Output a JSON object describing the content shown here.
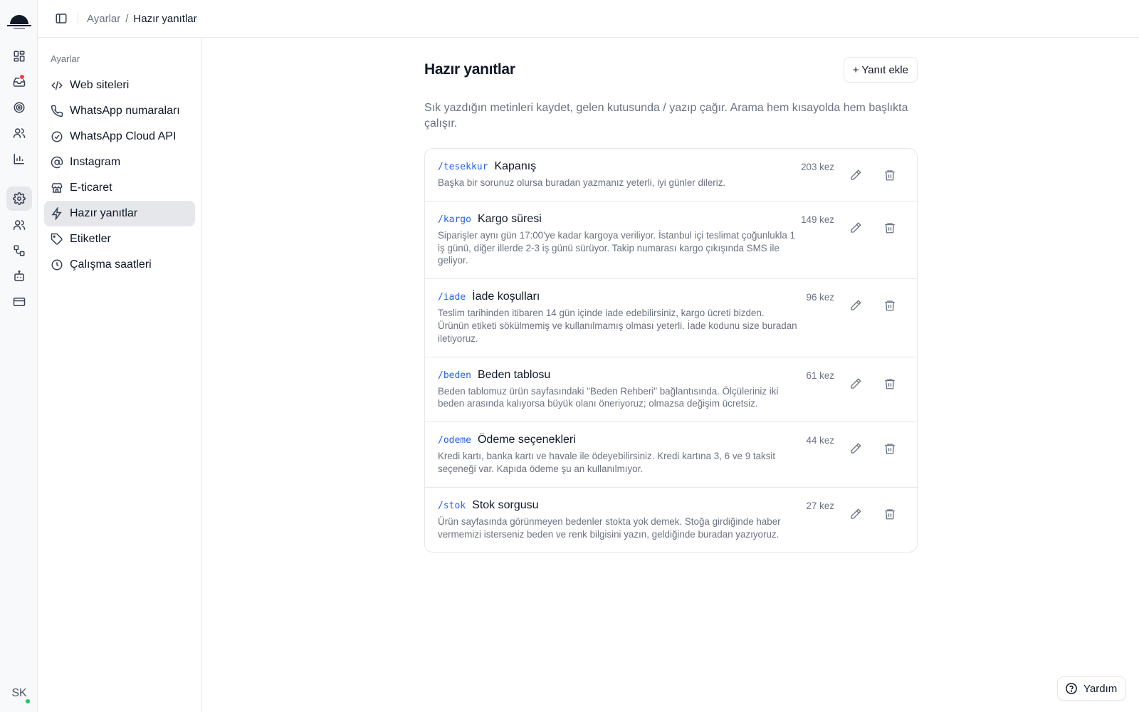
{
  "app": {
    "avatar_initials": "SK"
  },
  "breadcrumb": {
    "parent": "Ayarlar",
    "separator": "/",
    "current": "Hazır yanıtlar"
  },
  "rail": {
    "items": [
      {
        "icon": "dashboard-icon"
      },
      {
        "icon": "inbox-icon",
        "badge_color": "#ef4444"
      },
      {
        "icon": "target-icon"
      },
      {
        "icon": "contacts-icon"
      },
      {
        "icon": "chart-icon"
      },
      {
        "icon": "gear-icon",
        "active": true
      },
      {
        "icon": "team-icon"
      },
      {
        "icon": "flow-icon"
      },
      {
        "icon": "bot-icon"
      },
      {
        "icon": "card-icon"
      }
    ]
  },
  "settings_nav": {
    "title": "Ayarlar",
    "items": [
      {
        "label": "Web siteleri",
        "icon": "code-icon"
      },
      {
        "label": "WhatsApp numaraları",
        "icon": "phone-icon"
      },
      {
        "label": "WhatsApp Cloud API",
        "icon": "check-circle-icon"
      },
      {
        "label": "Instagram",
        "icon": "at-icon"
      },
      {
        "label": "E-ticaret",
        "icon": "store-icon"
      },
      {
        "label": "Hazır yanıtlar",
        "icon": "zap-icon",
        "active": true
      },
      {
        "label": "Etiketler",
        "icon": "tag-icon"
      },
      {
        "label": "Çalışma saatleri",
        "icon": "clock-icon"
      }
    ]
  },
  "page": {
    "title": "Hazır yanıtlar",
    "add_button": "+ Yanıt ekle",
    "description": "Sık yazdığın metinleri kaydet, gelen kutusunda / yazıp çağır. Arama hem kısayolda hem başlıkta çalışır."
  },
  "replies": [
    {
      "shortcut": "/tesekkur",
      "title": "Kapanış",
      "count": "203 kez",
      "body": "Başka bir sorunuz olursa buradan yazmanız yeterli, iyi günler dileriz."
    },
    {
      "shortcut": "/kargo",
      "title": "Kargo süresi",
      "count": "149 kez",
      "body": "Siparişler aynı gün 17:00'ye kadar kargoya veriliyor. İstanbul içi teslimat çoğunlukla 1 iş günü, diğer illerde 2-3 iş günü sürüyor. Takip numarası kargo çıkışında SMS ile geliyor."
    },
    {
      "shortcut": "/iade",
      "title": "İade koşulları",
      "count": "96 kez",
      "body": "Teslim tarihinden itibaren 14 gün içinde iade edebilirsiniz, kargo ücreti bizden. Ürünün etiketi sökülmemiş ve kullanılmamış olması yeterli. İade kodunu size buradan iletiyoruz."
    },
    {
      "shortcut": "/beden",
      "title": "Beden tablosu",
      "count": "61 kez",
      "body": "Beden tablomuz ürün sayfasındaki \"Beden Rehberi\" bağlantısında. Ölçüleriniz iki beden arasında kalıyorsa büyük olanı öneriyoruz; olmazsa değişim ücretsiz."
    },
    {
      "shortcut": "/odeme",
      "title": "Ödeme seçenekleri",
      "count": "44 kez",
      "body": "Kredi kartı, banka kartı ve havale ile ödeyebilirsiniz. Kredi kartına 3, 6 ve 9 taksit seçeneği var. Kapıda ödeme şu an kullanılmıyor."
    },
    {
      "shortcut": "/stok",
      "title": "Stok sorgusu",
      "count": "27 kez",
      "body": "Ürün sayfasında görünmeyen bedenler stokta yok demek. Stoğa girdiğinde haber vermemizi isterseniz beden ve renk bilgisini yazın, geldiğinde buradan yazıyoruz."
    }
  ],
  "help": {
    "label": "Yardım"
  },
  "colors": {
    "accent": "#2563eb",
    "active_bg": "#e5e7eb",
    "notification": "#ef4444",
    "online": "#22c55e"
  }
}
